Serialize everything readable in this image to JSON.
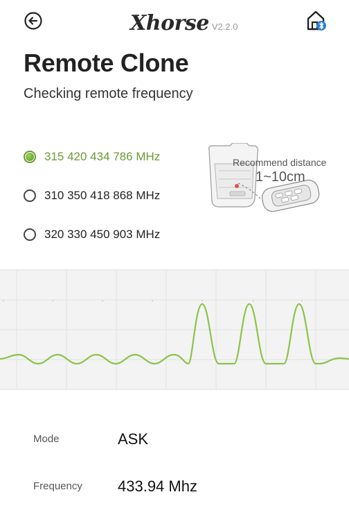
{
  "header": {
    "brand": "Xhorse",
    "version": "V2.2.0",
    "back_icon": "arrow-left-circle-icon",
    "home_icon": "home-bluetooth-icon"
  },
  "page": {
    "title": "Remote Clone",
    "subtitle": "Checking remote frequency"
  },
  "frequencies": [
    {
      "label": "315 420 434 786 MHz",
      "selected": true
    },
    {
      "label": "310 350 418 868 MHz",
      "selected": false
    },
    {
      "label": "320 330 450 903 MHz",
      "selected": false
    }
  ],
  "recommend": {
    "label": "Recommend distance",
    "distance": "1~10cm"
  },
  "colors": {
    "accent_green": "#8bc34a",
    "selected_text": "#6a9a34"
  },
  "info": {
    "mode_label": "Mode",
    "mode_value": "ASK",
    "frequency_label": "Frequency",
    "frequency_value": "433.94 Mhz"
  }
}
